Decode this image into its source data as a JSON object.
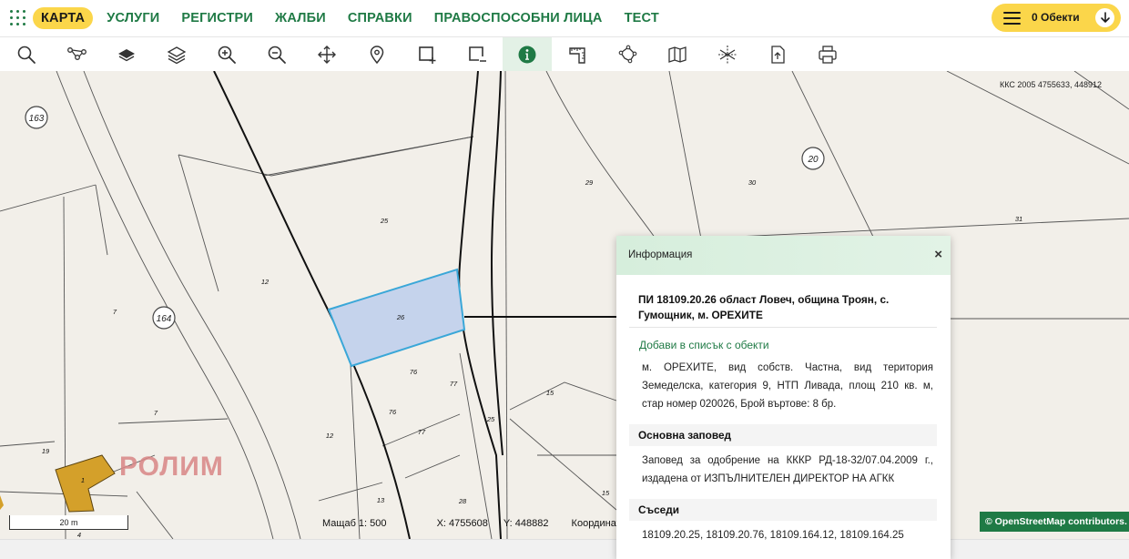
{
  "nav": {
    "items": [
      {
        "label": "КАРТА",
        "active": true
      },
      {
        "label": "УСЛУГИ"
      },
      {
        "label": "РЕГИСТРИ"
      },
      {
        "label": "ЖАЛБИ"
      },
      {
        "label": "СПРАВКИ"
      },
      {
        "label": "ПРАВОСПОСОБНИ ЛИЦА"
      },
      {
        "label": "ТЕСТ"
      }
    ],
    "objects_label": "0 Обекти"
  },
  "toolbar": {
    "tools": [
      "search-icon",
      "route-icon",
      "layers-icon",
      "layers-stack-icon",
      "zoom-in-icon",
      "zoom-out-icon",
      "pan-icon",
      "marker-icon",
      "select-rect-icon",
      "select-rect-minus-icon",
      "info-icon",
      "measure-icon",
      "polygon-icon",
      "map-icon",
      "cross-section-icon",
      "export-icon",
      "print-icon"
    ],
    "active": "info-icon"
  },
  "map": {
    "crs_readout": "ККС 2005 4755633, 448912",
    "watermark": "РОЛИМ",
    "circle_labels": [
      "163",
      "164",
      "20"
    ],
    "parcel_labels": [
      "25",
      "29",
      "30",
      "31",
      "12",
      "7",
      "26",
      "76",
      "77",
      "76",
      "77",
      "25",
      "15",
      "15",
      "7",
      "12",
      "13",
      "28",
      "19",
      "1",
      "4"
    ],
    "scale_label": "20 m",
    "status": {
      "scale": "Мащаб 1:  500",
      "x": "X:  4755608",
      "y": "Y:  448882",
      "coords": "Координат"
    },
    "attribution": "© OpenStreetMap contributors."
  },
  "panel": {
    "title": "Информация",
    "close": "×",
    "pi_title": "ПИ 18109.20.26 област Ловеч, община Троян, с. Гумощник, м. ОРЕХИТЕ",
    "add_link": "Добави в списък с обекти",
    "description": "м. ОРЕХИТЕ, вид собств. Частна, вид територия Земеделска, категория 9, НТП Ливада, площ 210 кв. м, стар номер 020026, Брой въртове: 8 бр.",
    "order_heading": "Основна заповед",
    "order_text": "Заповед за одобрение на КККР РД-18-32/07.04.2009 г., издадена от ИЗПЪЛНИТЕЛЕН ДИРЕКТОР НА АГКК",
    "neighbors_heading": "Съседи",
    "neighbors_text": "18109.20.25, 18109.20.76, 18109.164.12, 18109.164.25"
  },
  "colors": {
    "accent": "#1f7a45",
    "highlight": "#fbd64a",
    "parcel_fill": "#c5d3ec",
    "parcel_stroke": "#3aa7d8",
    "building": "#d4a02a"
  }
}
